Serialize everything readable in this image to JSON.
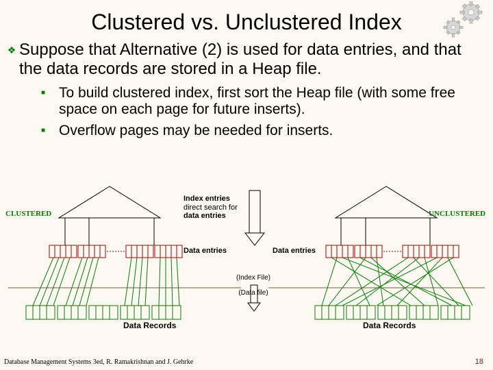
{
  "title": "Clustered vs. Unclustered Index",
  "bullets": {
    "b1": "Suppose that Alternative (2) is used for data entries, and that the data records are stored in a Heap file.",
    "b2a": " To build clustered index, first sort the Heap file (with some free space on each page for future inserts).",
    "b2b": "Overflow pages may be needed for inserts."
  },
  "diagram": {
    "clustered_label": "CLUSTERED",
    "unclustered_label": "UNCLUSTERED",
    "index_entries_l1": "Index entries",
    "index_entries_l2": "direct search for",
    "index_entries_l3": "data entries",
    "data_entries": "Data entries",
    "index_file": "(Index File)",
    "data_file": "(Data file)",
    "data_records": "Data Records"
  },
  "footer": "Database Management Systems 3ed, R. Ramakrishnan and J. Gehrke",
  "slide_number": "18",
  "icons": {
    "gear": "gear-icon"
  }
}
